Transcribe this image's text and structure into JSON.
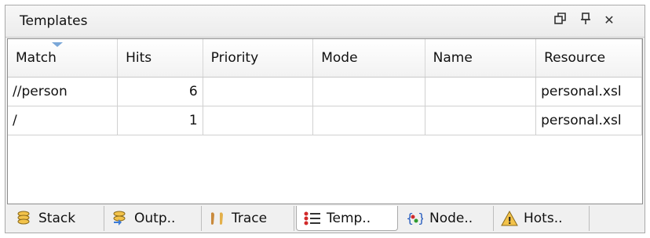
{
  "panel": {
    "title": "Templates",
    "controls": [
      "restore-icon",
      "pin-icon",
      "close-icon"
    ],
    "close_glyph": "✕",
    "pin_glyph": "Ҏ"
  },
  "table": {
    "columns": [
      "Match",
      "Hits",
      "Priority",
      "Mode",
      "Name",
      "Resource"
    ],
    "rows": [
      {
        "match": "//person",
        "hits": "6",
        "priority": "",
        "mode": "",
        "name": "",
        "resource": "personal.xsl"
      },
      {
        "match": "/",
        "hits": "1",
        "priority": "",
        "mode": "",
        "name": "",
        "resource": "personal.xsl"
      }
    ]
  },
  "tabs": [
    {
      "label": "Stack",
      "icon": "stack-icon",
      "active": false
    },
    {
      "label": "Outp..",
      "icon": "output-icon",
      "active": false
    },
    {
      "label": "Trace",
      "icon": "trace-icon",
      "active": false
    },
    {
      "label": "Temp..",
      "icon": "templates-icon",
      "active": true
    },
    {
      "label": "Node..",
      "icon": "node-icon",
      "active": false
    },
    {
      "label": "Hots..",
      "icon": "hotspots-icon",
      "active": false
    }
  ],
  "colors": {
    "sort_arrow": "#7aa7d8",
    "active_tab": "#ffffff"
  }
}
